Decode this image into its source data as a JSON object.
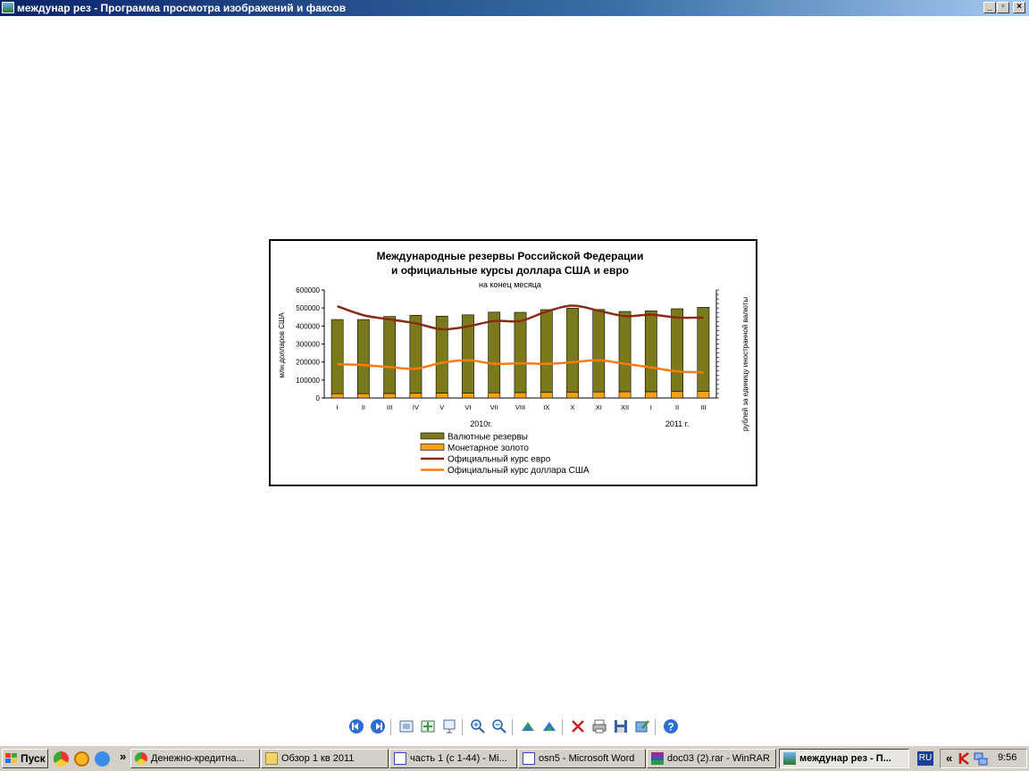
{
  "window": {
    "title": "междунар рез - Программа просмотра изображений и факсов"
  },
  "chart_data": {
    "type": "bar",
    "title_line1": "Международные резервы Российской Федерации",
    "title_line2": "и официальные курсы доллара США и евро",
    "subtitle": "на конец месяца",
    "ylabel": "млн.долларов США",
    "y2label": "рублей за единицу иностранной валюты",
    "ylim": [
      0,
      600000
    ],
    "yticks": [
      "600000",
      "500000",
      "400000",
      "300000",
      "200000",
      "100000",
      "0"
    ],
    "categories": [
      "I",
      "II",
      "III",
      "IV",
      "V",
      "VI",
      "VII",
      "VIII",
      "IX",
      "X",
      "XI",
      "XII",
      "I",
      "II",
      "III"
    ],
    "year_labels": [
      "2010г.",
      "2011 г."
    ],
    "series": [
      {
        "name": "Валютные резервы",
        "kind": "bar",
        "color": "#7a7a1c",
        "values": [
          412000,
          412000,
          428000,
          434000,
          428000,
          434000,
          448000,
          446000,
          460000,
          466000,
          458000,
          446000,
          449000,
          460000,
          466000
        ]
      },
      {
        "name": "Монетарное золото",
        "kind": "bar",
        "color": "#f5a11c",
        "values": [
          24000,
          24000,
          25000,
          26000,
          27000,
          28000,
          29000,
          30000,
          31000,
          33000,
          34000,
          35000,
          35000,
          36000,
          38000
        ]
      },
      {
        "name": "Официальный курс евро",
        "kind": "line",
        "color": "#8b2a12",
        "values": [
          510000,
          460000,
          437000,
          415000,
          382000,
          398000,
          428000,
          428000,
          480000,
          513000,
          485000,
          455000,
          463000,
          447000,
          447000
        ]
      },
      {
        "name": "Официальный курс доллара США",
        "kind": "line",
        "color": "#ff7a10",
        "values": [
          188000,
          183000,
          172000,
          163000,
          196000,
          210000,
          190000,
          193000,
          190000,
          199000,
          210000,
          190000,
          170000,
          148000,
          143000
        ]
      }
    ]
  },
  "viewer_toolbar": {
    "buttons": [
      "previous-image-icon",
      "next-image-icon",
      "best-fit-icon",
      "actual-size-icon",
      "slideshow-icon",
      "zoom-in-icon",
      "zoom-out-icon",
      "rotate-clockwise-icon",
      "rotate-counterclockwise-icon",
      "delete-icon",
      "print-icon",
      "save-icon",
      "edit-icon",
      "help-icon"
    ]
  },
  "taskbar": {
    "start_label": "Пуск",
    "buttons": [
      {
        "label": "Денежно-кредитна...",
        "icon": "chrome-icon"
      },
      {
        "label": "Обзор 1 кв 2011",
        "icon": "folder-icon"
      },
      {
        "label": "часть 1 (с 1-44) - Mi...",
        "icon": "word-doc-icon"
      },
      {
        "label": "osn5 - Microsoft Word",
        "icon": "word-doc-icon"
      },
      {
        "label": "doc03 (2).rar - WinRAR",
        "icon": "winrar-icon"
      },
      {
        "label": "междунар рез - П...",
        "icon": "image-viewer-icon",
        "active": true
      }
    ],
    "language": "RU",
    "clock": "9:56"
  }
}
